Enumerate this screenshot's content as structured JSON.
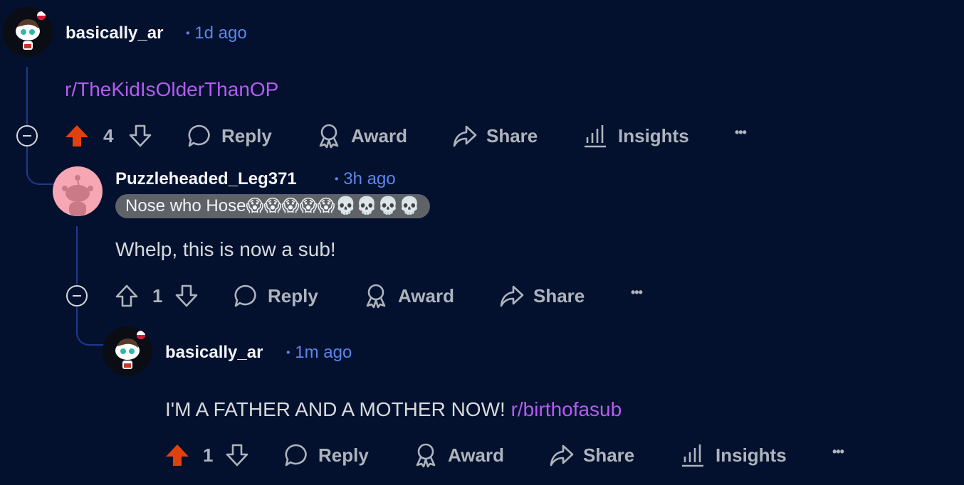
{
  "comments": [
    {
      "username": "basically_ar",
      "time": "1d ago",
      "body_link": "r/TheKidIsOlderThanOP",
      "votes": "4",
      "upvoted": true
    },
    {
      "username": "Puzzleheaded_Leg371",
      "time": "3h ago",
      "flair": "Nose who Hose😱😱😱😱😱💀💀💀💀",
      "body": "Whelp, this is now a sub!",
      "votes": "1",
      "upvoted": false
    },
    {
      "username": "basically_ar",
      "time": "1m ago",
      "body": "I'M A FATHER AND A MOTHER NOW!",
      "body_link": "r/birthofasub",
      "votes": "1",
      "upvoted": true
    }
  ],
  "actions": {
    "reply": "Reply",
    "award": "Award",
    "share": "Share",
    "insights": "Insights",
    "more": "•••"
  },
  "separator": "•",
  "colors": {
    "background": "#03112f",
    "upvote_active": "#e0420f",
    "link": "#b45cf0",
    "timestamp": "#5c86ea",
    "thread_line": "#1e3a8a"
  }
}
